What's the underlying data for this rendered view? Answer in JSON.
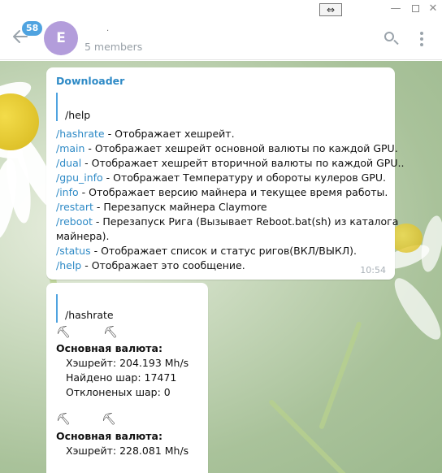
{
  "window": {
    "resize_glyph": "⇔",
    "minimize_glyph": "—",
    "close_glyph": "✕"
  },
  "header": {
    "badge_count": "58",
    "avatar_letter": "E",
    "title": ".",
    "members": "5 members"
  },
  "messages": [
    {
      "sender": "Downloader",
      "reply": "/help",
      "lines": [
        {
          "cmd": "/hashrate",
          "text": " - Отображает хешрейт."
        },
        {
          "cmd": "/main",
          "text": " - Отображает хешрейт основной валюты по каждой GPU."
        },
        {
          "cmd": "/dual",
          "text": " - Отображает хешрейт вторичной валюты по каждой GPU.."
        },
        {
          "cmd": "/gpu_info",
          "text": " - Отображает Температуру и обороты кулеров GPU."
        },
        {
          "cmd": "/info",
          "text": " - Отображает версию майнера и текущее время работы."
        },
        {
          "cmd": "/restart",
          "text": " - Перезапуск майнера Claymore"
        },
        {
          "cmd": "/reboot",
          "text": " - Перезапуск Рига (Вызывает Reboot.bat(sh) из каталога"
        },
        {
          "cmd": "",
          "text": "майнера)."
        },
        {
          "cmd": "/status",
          "text": " - Отображает список и статус ригов(ВКЛ/ВЫКЛ)."
        },
        {
          "cmd": "/help",
          "text": " - Отображает это сообщение."
        }
      ],
      "time": "10:54"
    },
    {
      "reply": "/hashrate",
      "picks": "⛏",
      "block1": {
        "heading": "Основная валюта:",
        "hashrate": "Хэшрейт: 204.193 Mh/s",
        "shares": "Найдено шар: 17471",
        "rejected": "Отклоненых шар: 0"
      },
      "block2": {
        "heading": "Основная валюта:",
        "hashrate": "Хэшрейт: 228.081 Mh/s"
      }
    }
  ],
  "colors": {
    "accent": "#2e8ac6",
    "badge": "#4fa3e0",
    "avatar": "#b39ddb"
  }
}
